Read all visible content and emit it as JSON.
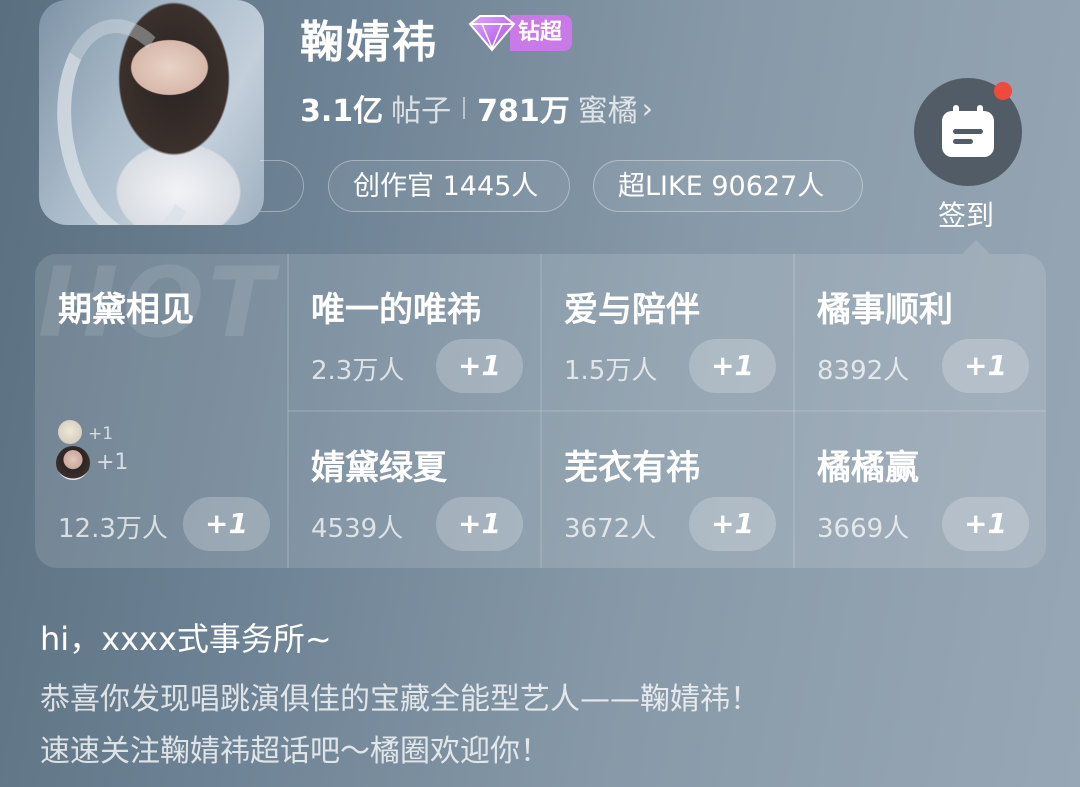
{
  "profile": {
    "name": "鞠婧祎",
    "badge_label": "钻超",
    "posts_count": "3.1亿",
    "posts_label": "帖子",
    "fans_count": "781万",
    "fans_label": "蜜橘",
    "fans_chevron": "›"
  },
  "tags": {
    "creator_label": "创作官 1445人",
    "superlike_label": "超LIKE 90627人"
  },
  "checkin": {
    "label": "签到",
    "icon": "calendar-icon",
    "has_notification_dot": true
  },
  "grid": {
    "watermark": "HOT",
    "featured": {
      "title": "期黛相见",
      "count": "12.3万人",
      "button": "+1",
      "mini1_plus": "+1",
      "mini2_plus": "+1"
    },
    "cells": [
      {
        "title": "唯一的唯祎",
        "count": "2.3万人",
        "button": "+1"
      },
      {
        "title": "爱与陪伴",
        "count": "1.5万人",
        "button": "+1"
      },
      {
        "title": "橘事顺利",
        "count": "8392人",
        "button": "+1"
      },
      {
        "title": "婧黛绿夏",
        "count": "4539人",
        "button": "+1"
      },
      {
        "title": "芜衣有祎",
        "count": "3672人",
        "button": "+1"
      },
      {
        "title": "橘橘赢",
        "count": "3669人",
        "button": "+1"
      }
    ]
  },
  "intro": {
    "greeting": "hi，xxxx式事务所~",
    "line1": "恭喜你发现唱跳演俱佳的宝藏全能型艺人——鞠婧祎！",
    "line2": "速速关注鞠婧祎超话吧～橘圈欢迎你！"
  },
  "colors": {
    "badge": "#c97ae6",
    "notification_dot": "#f04a3d",
    "checkin_bg": "#525c67"
  }
}
